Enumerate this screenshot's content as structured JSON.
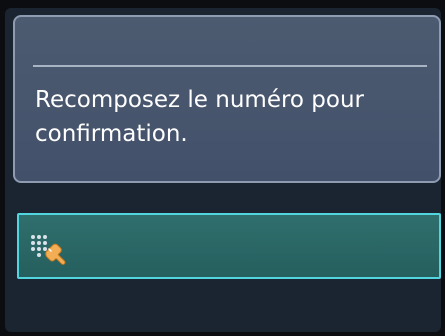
{
  "dialog": {
    "message": "Recomposez le numéro pour confirmation."
  },
  "input": {
    "icon": "keypad-touch-icon",
    "value": ""
  }
}
